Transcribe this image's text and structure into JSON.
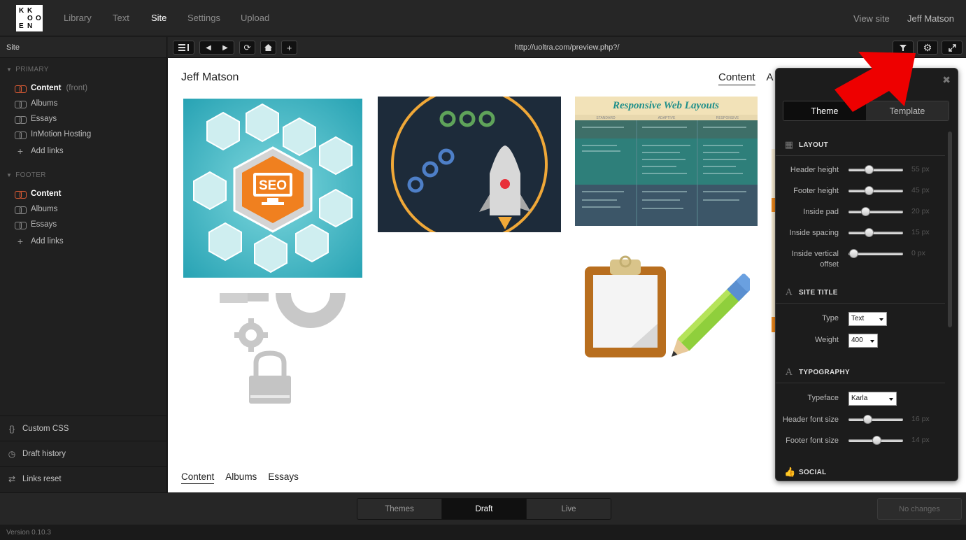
{
  "logo": {
    "letters": [
      "K",
      "K",
      "O",
      "E",
      "N",
      "O"
    ]
  },
  "nav": {
    "items": [
      "Library",
      "Text",
      "Site",
      "Settings",
      "Upload"
    ],
    "active": "Site",
    "view_site": "View site",
    "user": "Jeff Matson"
  },
  "sidebar": {
    "title": "Site",
    "primary_label": "PRIMARY",
    "primary_items": [
      {
        "label": "Content",
        "sub": "(front)"
      },
      {
        "label": "Albums"
      },
      {
        "label": "Essays"
      },
      {
        "label": "InMotion Hosting"
      },
      {
        "label": "Add links"
      }
    ],
    "footer_label": "FOOTER",
    "footer_items": [
      {
        "label": "Content"
      },
      {
        "label": "Albums"
      },
      {
        "label": "Essays"
      },
      {
        "label": "Add links"
      }
    ],
    "tools": [
      "Custom CSS",
      "Draft history",
      "Links reset"
    ]
  },
  "toolbar": {
    "url": "http://uoltra.com/preview.php?/"
  },
  "preview": {
    "site_title": "Jeff Matson",
    "nav_top": [
      "Content",
      "A"
    ],
    "nav_bottom": [
      "Content",
      "Albums",
      "Essays"
    ],
    "seo_text": "SEO",
    "layouts_title": "Responsive Web Layouts",
    "layouts_cols": [
      "STANDARD",
      "ADAPTIVE",
      "RESPONSIVE"
    ]
  },
  "panel": {
    "tabs": [
      "Theme",
      "Template"
    ],
    "active_tab": "Theme",
    "layout_head": "LAYOUT",
    "layout_rows": [
      {
        "label": "Header height",
        "value": "55 px",
        "level": 0.35
      },
      {
        "label": "Footer height",
        "value": "45 px",
        "level": 0.36
      },
      {
        "label": "Inside pad",
        "value": "20 px",
        "level": 0.28
      },
      {
        "label": "Inside spacing",
        "value": "15 px",
        "level": 0.36
      },
      {
        "label": "Inside vertical offset",
        "value": "0 px",
        "level": 0.02
      }
    ],
    "site_title_head": "SITE TITLE",
    "type_label": "Type",
    "type_value": "Text",
    "weight_label": "Weight",
    "weight_value": "400",
    "typography_head": "TYPOGRAPHY",
    "typeface_label": "Typeface",
    "typeface_value": "Karla",
    "font_rows": [
      {
        "label": "Header font size",
        "value": "16 px",
        "level": 0.33
      },
      {
        "label": "Footer font size",
        "value": "14 px",
        "level": 0.52
      }
    ],
    "social_head": "SOCIAL"
  },
  "bottom": {
    "modes": [
      "Themes",
      "Draft",
      "Live"
    ],
    "active_mode": "Draft",
    "no_changes": "No changes"
  },
  "version": "Version 0.10.3",
  "colors": {
    "accent": "#e25d35",
    "arrow": "#ee0000",
    "panel_bg": "#1c1c1c"
  }
}
